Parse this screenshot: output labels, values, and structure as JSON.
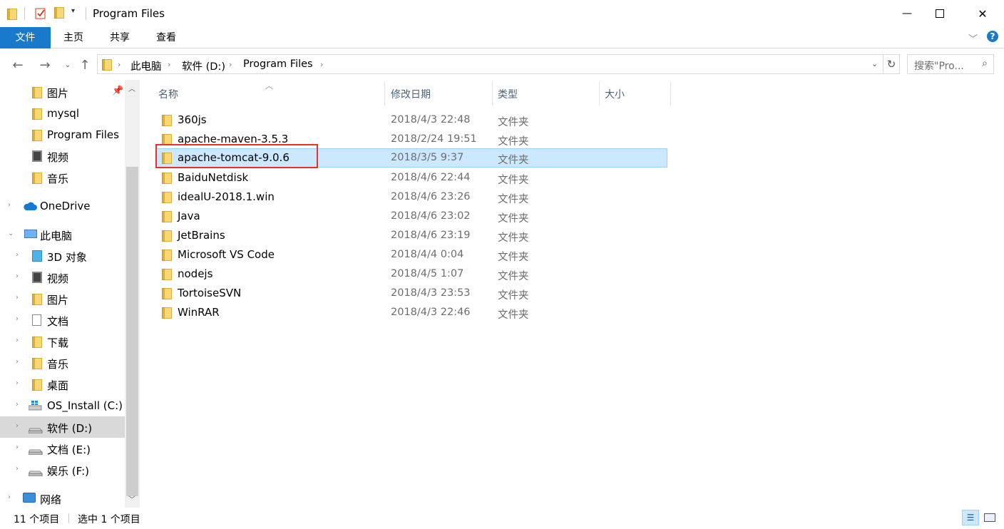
{
  "window": {
    "title": "Program Files",
    "minimize_glyph": "—",
    "maximize_glyph": "☐",
    "close_glyph": "✕"
  },
  "ribbon": {
    "tabs": [
      "文件",
      "主页",
      "共享",
      "查看"
    ]
  },
  "address": {
    "crumbs": [
      "此电脑",
      "软件 (D:)",
      "Program Files"
    ],
    "search_placeholder": "搜索\"Pro..."
  },
  "sidebar": {
    "items": [
      {
        "label": "图片",
        "icon": "pictures-folder-icon",
        "pinned": true
      },
      {
        "label": "mysql",
        "icon": "folder-icon"
      },
      {
        "label": "Program Files",
        "icon": "folder-icon"
      },
      {
        "label": "视频",
        "icon": "videos-folder-icon"
      },
      {
        "label": "音乐",
        "icon": "music-folder-icon"
      },
      {
        "label": "OneDrive",
        "icon": "onedrive-cloud-icon"
      },
      {
        "label": "此电脑",
        "icon": "this-pc-icon"
      },
      {
        "label": "3D 对象",
        "icon": "3d-objects-icon"
      },
      {
        "label": "视频",
        "icon": "videos-folder-icon"
      },
      {
        "label": "图片",
        "icon": "pictures-folder-icon"
      },
      {
        "label": "文档",
        "icon": "documents-folder-icon"
      },
      {
        "label": "下载",
        "icon": "downloads-folder-icon"
      },
      {
        "label": "音乐",
        "icon": "music-folder-icon"
      },
      {
        "label": "桌面",
        "icon": "desktop-folder-icon"
      },
      {
        "label": "OS_Install (C:)",
        "icon": "windows-drive-icon"
      },
      {
        "label": "软件 (D:)",
        "icon": "drive-icon",
        "selected": true
      },
      {
        "label": "文档 (E:)",
        "icon": "drive-icon"
      },
      {
        "label": "娱乐 (F:)",
        "icon": "drive-icon"
      },
      {
        "label": "网络",
        "icon": "network-icon"
      }
    ]
  },
  "columns": [
    "名称",
    "修改日期",
    "类型",
    "大小"
  ],
  "files": [
    {
      "name": "360js",
      "date": "2018/4/3 22:48",
      "type": "文件夹"
    },
    {
      "name": "apache-maven-3.5.3",
      "date": "2018/2/24 19:51",
      "type": "文件夹"
    },
    {
      "name": "apache-tomcat-9.0.6",
      "date": "2018/3/5 9:37",
      "type": "文件夹",
      "selected": true
    },
    {
      "name": "BaiduNetdisk",
      "date": "2018/4/6 22:44",
      "type": "文件夹"
    },
    {
      "name": "idealU-2018.1.win",
      "date": "2018/4/6 23:26",
      "type": "文件夹"
    },
    {
      "name": "Java",
      "date": "2018/4/6 23:02",
      "type": "文件夹"
    },
    {
      "name": "JetBrains",
      "date": "2018/4/6 23:19",
      "type": "文件夹"
    },
    {
      "name": "Microsoft VS Code",
      "date": "2018/4/4 0:04",
      "type": "文件夹"
    },
    {
      "name": "nodejs",
      "date": "2018/4/5 1:07",
      "type": "文件夹"
    },
    {
      "name": "TortoiseSVN",
      "date": "2018/4/3 23:53",
      "type": "文件夹"
    },
    {
      "name": "WinRAR",
      "date": "2018/4/3 22:46",
      "type": "文件夹"
    }
  ],
  "status": {
    "count": "11 个项目",
    "selected": "选中 1 个项目"
  },
  "colors": {
    "accent": "#1979ca",
    "selection": "#cce8ff",
    "highlight_box": "#e8302d"
  }
}
